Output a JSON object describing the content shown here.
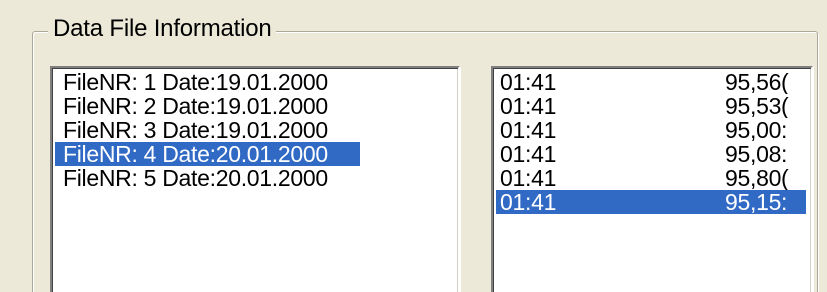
{
  "group": {
    "title": "Data File Information"
  },
  "files": {
    "items": [
      "FileNR: 1 Date:19.01.2000",
      "FileNR: 2 Date:19.01.2000",
      "FileNR: 3 Date:19.01.2000",
      "FileNR: 4 Date:20.01.2000",
      "FileNR: 5 Date:20.01.2000"
    ],
    "selected_index": 3
  },
  "records": {
    "items": [
      {
        "time": "01:41",
        "value": "95,56("
      },
      {
        "time": "01:41",
        "value": "95,53("
      },
      {
        "time": "01:41",
        "value": "95,00:"
      },
      {
        "time": "01:41",
        "value": "95,08:"
      },
      {
        "time": "01:41",
        "value": "95,80("
      },
      {
        "time": "01:41",
        "value": "95,15:"
      }
    ],
    "selected_index": 5
  },
  "colors": {
    "window_bg": "#ece9d8",
    "selection_bg": "#316ac5",
    "selection_fg": "#ffffff"
  }
}
